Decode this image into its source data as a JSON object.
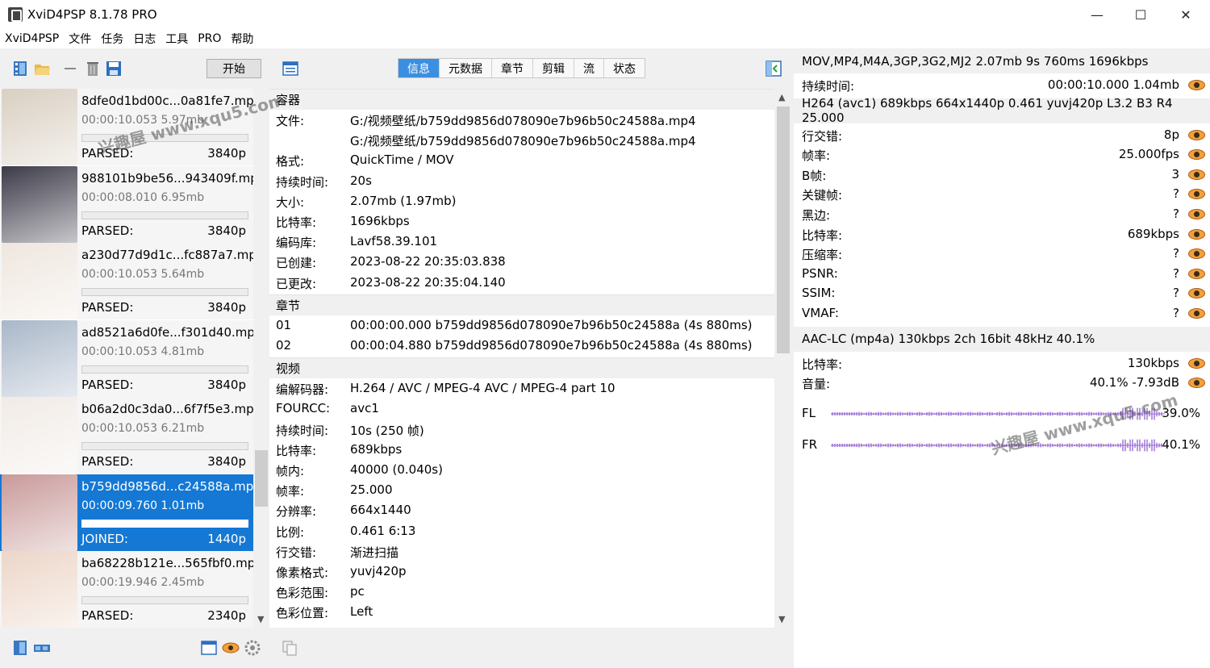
{
  "window": {
    "title": "XviD4PSP 8.1.78 PRO",
    "minimize": "—",
    "maximize": "☐",
    "close": "✕"
  },
  "menu": [
    "XviD4PSP",
    "文件",
    "任务",
    "日志",
    "工具",
    "PRO",
    "帮助"
  ],
  "toolbar": {
    "start_label": "开始",
    "tabs": [
      "信息",
      "元数据",
      "章节",
      "剪辑",
      "流",
      "状态"
    ],
    "active_tab": 0
  },
  "files": [
    {
      "name": "8dfe0d1bd00c...0a81fe7.mp4",
      "duration": "00:00:10.053 5.97mb",
      "state": "PARSED:",
      "res": "3840p",
      "thumb": "#d9cfc2"
    },
    {
      "name": "988101b9be56...943409f.mp4",
      "duration": "00:00:08.010 6.95mb",
      "state": "PARSED:",
      "res": "3840p",
      "thumb": "#3b3a48"
    },
    {
      "name": "a230d77d9d1c...fc887a7.mp4",
      "duration": "00:00:10.053 5.64mb",
      "state": "PARSED:",
      "res": "3840p",
      "thumb": "#efe7df"
    },
    {
      "name": "ad8521a6d0fe...f301d40.mp4",
      "duration": "00:00:10.053 4.81mb",
      "state": "PARSED:",
      "res": "3840p",
      "thumb": "#a9b7c9"
    },
    {
      "name": "b06a2d0c3da0...6f7f5e3.mp4",
      "duration": "00:00:10.053 6.21mb",
      "state": "PARSED:",
      "res": "3840p",
      "thumb": "#f1ebe6"
    },
    {
      "name": "b759dd9856d...c24588a.mp4",
      "duration": "00:00:09.760 1.01mb",
      "state": "JOINED:",
      "res": "1440p",
      "thumb": "#c99a9a",
      "selected": true
    },
    {
      "name": "ba68228b121e...565fbf0.mp4",
      "duration": "00:00:19.946 2.45mb",
      "state": "PARSED:",
      "res": "2340p",
      "thumb": "#ecd6c8"
    }
  ],
  "info": {
    "container_title": "容器",
    "container": [
      {
        "k": "文件:",
        "v": "G:/视频壁纸/b759dd9856d078090e7b96b50c24588a.mp4"
      },
      {
        "k": "",
        "v": "G:/视频壁纸/b759dd9856d078090e7b96b50c24588a.mp4"
      },
      {
        "k": "格式:",
        "v": "QuickTime / MOV"
      },
      {
        "k": "持续时间:",
        "v": "20s"
      },
      {
        "k": "大小:",
        "v": "2.07mb (1.97mb)"
      },
      {
        "k": "比特率:",
        "v": "1696kbps"
      },
      {
        "k": "编码库:",
        "v": "Lavf58.39.101"
      },
      {
        "k": "已创建:",
        "v": "2023-08-22 20:35:03.838"
      },
      {
        "k": "已更改:",
        "v": "2023-08-22 20:35:04.140"
      }
    ],
    "chapters_title": "章节",
    "chapters": [
      {
        "k": "01",
        "v": "00:00:00.000 b759dd9856d078090e7b96b50c24588a (4s 880ms)"
      },
      {
        "k": "02",
        "v": "00:00:04.880 b759dd9856d078090e7b96b50c24588a (4s 880ms)"
      }
    ],
    "video_title": "视频",
    "video": [
      {
        "k": "编解码器:",
        "v": "H.264 / AVC / MPEG-4 AVC / MPEG-4 part 10"
      },
      {
        "k": "FOURCC:",
        "v": "avc1"
      },
      {
        "k": "持续时间:",
        "v": "10s (250 帧)"
      },
      {
        "k": "比特率:",
        "v": "689kbps"
      },
      {
        "k": "帧内:",
        "v": "40000 (0.040s)"
      },
      {
        "k": "帧率:",
        "v": "25.000"
      },
      {
        "k": "分辨率:",
        "v": "664x1440"
      },
      {
        "k": "比例:",
        "v": "0.461 6:13"
      },
      {
        "k": "行交错:",
        "v": "渐进扫描"
      },
      {
        "k": "像素格式:",
        "v": "yuvj420p"
      },
      {
        "k": "色彩范围:",
        "v": "pc"
      },
      {
        "k": "色彩位置:",
        "v": "Left"
      }
    ]
  },
  "right": {
    "container_head": "MOV,MP4,M4A,3GP,3G2,MJ2 2.07mb 9s 760ms 1696kbps",
    "container_rows": [
      {
        "k": "持续时间:",
        "v": "00:00:10.000 1.04mb"
      }
    ],
    "video_head": "H264 (avc1) 689kbps 664x1440p 0.461 yuvj420p L3.2 B3 R4 25.000",
    "video_rows": [
      {
        "k": "行交错:",
        "v": "8p"
      },
      {
        "k": "帧率:",
        "v": "25.000fps"
      },
      {
        "k": "B帧:",
        "v": "3"
      },
      {
        "k": "关键帧:",
        "v": "?"
      },
      {
        "k": "黑边:",
        "v": "?"
      },
      {
        "k": "比特率:",
        "v": "689kbps"
      },
      {
        "k": "压缩率:",
        "v": "?"
      },
      {
        "k": "PSNR:",
        "v": "?"
      },
      {
        "k": "SSIM:",
        "v": "?"
      },
      {
        "k": "VMAF:",
        "v": "?"
      }
    ],
    "audio_head": "AAC-LC (mp4a) 130kbps 2ch 16bit 48kHz 40.1%",
    "audio_rows": [
      {
        "k": "比特率:",
        "v": "130kbps"
      },
      {
        "k": "音量:",
        "v": "40.1% -7.93dB"
      }
    ],
    "channels": [
      {
        "name": "FL",
        "pct": "39.0%"
      },
      {
        "name": "FR",
        "pct": "40.1%"
      }
    ],
    "wave_color": "#9a6bd6"
  },
  "watermark": "兴趣屋 www.xqu5.com"
}
